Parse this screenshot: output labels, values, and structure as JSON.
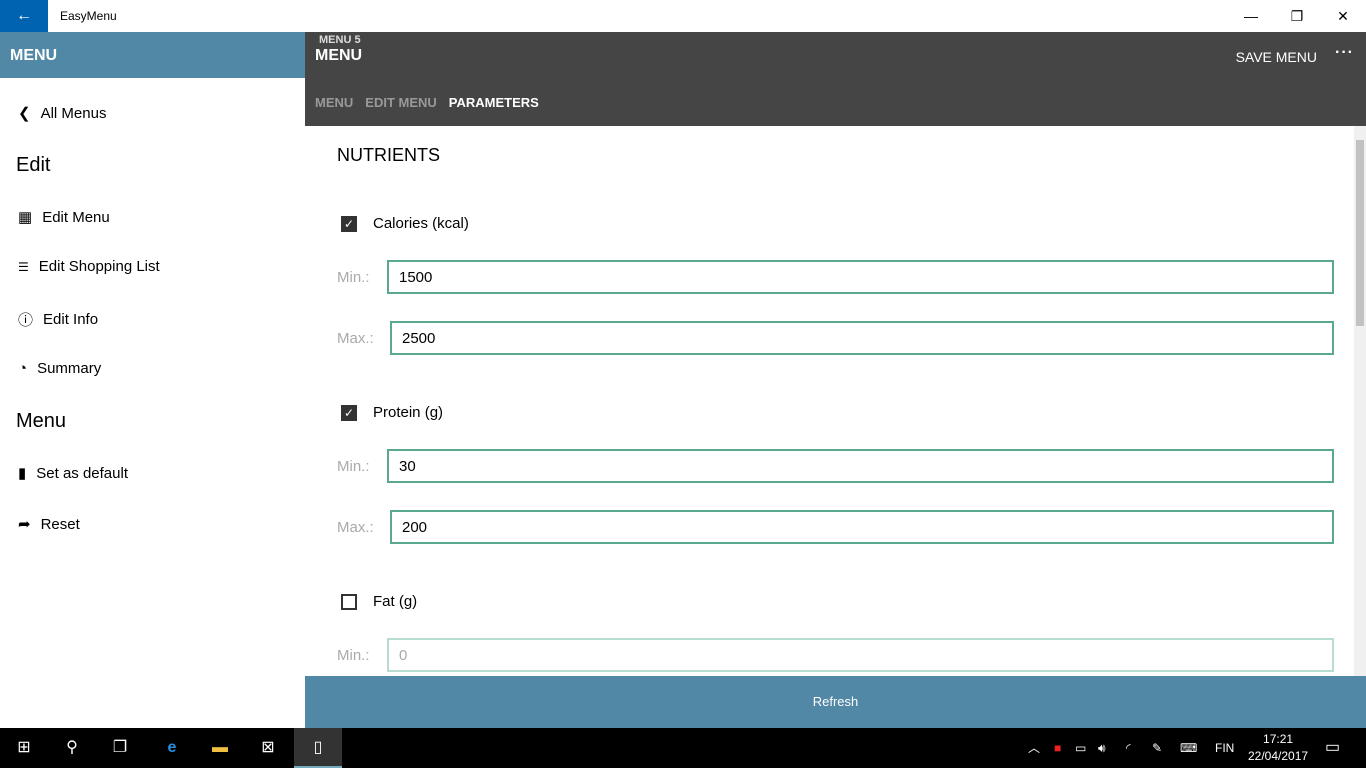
{
  "window": {
    "title": "EasyMenu",
    "back": "←",
    "minimize": "—",
    "maximize": "❐",
    "close": "✕"
  },
  "sidebar": {
    "header": "MENU",
    "back_label": "All Menus",
    "edit_heading": "Edit",
    "menu_heading": "Menu",
    "items": [
      {
        "label": "Edit Menu",
        "icon": "grid-icon"
      },
      {
        "label": "Edit Shopping List",
        "icon": "list-icon"
      },
      {
        "label": "Edit Info",
        "icon": "info-icon"
      },
      {
        "label": "Summary",
        "icon": "pie-chart-icon"
      },
      {
        "label": "Set as default",
        "icon": "bookmark-icon"
      },
      {
        "label": "Reset",
        "icon": "share-arrow-icon"
      }
    ]
  },
  "header": {
    "subtitle": "MENU 5",
    "title": "MENU",
    "save": "SAVE MENU",
    "more": "···",
    "tabs": [
      {
        "label": "MENU"
      },
      {
        "label": "EDIT MENU"
      },
      {
        "label": "PARAMETERS",
        "active": true
      }
    ]
  },
  "main": {
    "section": "NUTRIENTS",
    "min_label": "Min.:",
    "max_label": "Max.:",
    "nutrients": [
      {
        "name": "Calories (kcal)",
        "checked": true,
        "min": "1500",
        "max": "2500"
      },
      {
        "name": "Protein (g)",
        "checked": true,
        "min": "30",
        "max": "200"
      },
      {
        "name": "Fat (g)",
        "checked": false,
        "min": "0"
      }
    ],
    "refresh": "Refresh"
  },
  "taskbar": {
    "language": "FIN",
    "time": "17:21",
    "date": "22/04/2017"
  },
  "colors": {
    "accent": "#5088a6",
    "header": "#454545",
    "input_border": "#5aa88e",
    "title_back": "#0063b1"
  }
}
